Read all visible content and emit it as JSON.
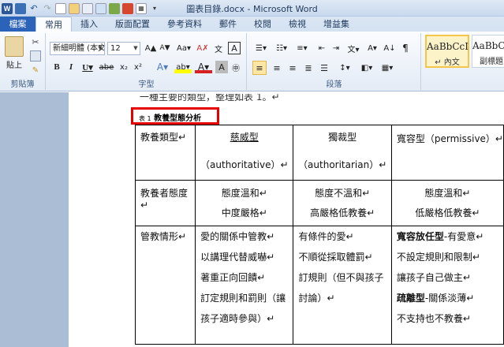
{
  "window": {
    "title": "圖表目錄.docx - Microsoft Word"
  },
  "tabs": [
    {
      "label": "檔案"
    },
    {
      "label": "常用"
    },
    {
      "label": "插入"
    },
    {
      "label": "版面配置"
    },
    {
      "label": "參考資料"
    },
    {
      "label": "郵件"
    },
    {
      "label": "校閱"
    },
    {
      "label": "檢視"
    },
    {
      "label": "增益集"
    }
  ],
  "ribbon": {
    "clipboard": {
      "paste_label": "貼上",
      "group_label": "剪貼簿"
    },
    "font": {
      "font_name": "新細明體 (本文",
      "font_size": "12",
      "group_label": "字型"
    },
    "paragraph": {
      "group_label": "段落"
    },
    "styles": [
      {
        "sample": "AaBbCcI",
        "name": "↵ 內文"
      },
      {
        "sample": "AaBbCcI",
        "name": "副標題"
      }
    ]
  },
  "document": {
    "prev_line": "一種主要的類型，整理如表 1。↵",
    "caption_prefix": "表 1",
    "caption_title": "教養型態分析",
    "header_row": {
      "c1": "教養類型↵",
      "c2": {
        "line1": "慈威型",
        "line2": "（authoritative）↵"
      },
      "c3": {
        "line1": "獨裁型",
        "line2": "（authoritarian）↵"
      },
      "c4": "寬容型（permissive）↵"
    },
    "attitude_row": {
      "c1": "教養者態度↵",
      "c2": {
        "line1": "態度溫和↵",
        "line2": "中度嚴格↵"
      },
      "c3": {
        "line1": "態度不溫和↵",
        "line2": "高嚴格低教養↵"
      },
      "c4": {
        "line1": "態度溫和↵",
        "line2": "低嚴格低教養↵"
      }
    },
    "discipline_row": {
      "c1": "管教情形↵",
      "c2": [
        "愛的關係中管教↵",
        "以講理代替威嚇↵",
        "著重正向回饋↵",
        "訂定規則和罰則（讓",
        "孩子適時參與）↵"
      ],
      "c3": [
        "有條件的愛↵",
        "不順從採取體罰↵",
        "訂規則（但不與孩子",
        "討論）↵"
      ],
      "c4": [
        {
          "bold": "寬容放任型",
          "rest": "-有愛意↵"
        },
        {
          "bold": "",
          "rest": "不設定規則和限制↵"
        },
        {
          "bold": "",
          "rest": "讓孩子自己做主↵"
        },
        {
          "bold": "疏離型",
          "rest": "-關係淡薄↵"
        },
        {
          "bold": "",
          "rest": "不支持也不教養↵"
        }
      ]
    }
  }
}
